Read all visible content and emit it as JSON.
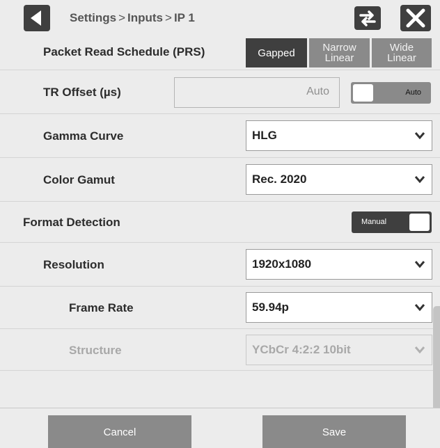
{
  "breadcrumb": {
    "part1": "Settings",
    "part2": "Inputs",
    "part3": "IP 1",
    "separator": ">"
  },
  "prs": {
    "label": "Packet Read Schedule (PRS)",
    "options": [
      {
        "line1": "Gapped",
        "line2": ""
      },
      {
        "line1": "Narrow",
        "line2": "Linear"
      },
      {
        "line1": "Wide",
        "line2": "Linear"
      }
    ],
    "selected": "Gapped"
  },
  "tr_offset": {
    "label": "TR Offset (µs)",
    "value": "Auto",
    "toggle_label": "Auto"
  },
  "gamma_curve": {
    "label": "Gamma Curve",
    "value": "HLG"
  },
  "color_gamut": {
    "label": "Color Gamut",
    "value": "Rec. 2020"
  },
  "format_detection": {
    "label": "Format Detection",
    "toggle_label": "Manual"
  },
  "resolution": {
    "label": "Resolution",
    "value": "1920x1080"
  },
  "frame_rate": {
    "label": "Frame Rate",
    "value": "59.94p"
  },
  "structure": {
    "label": "Structure",
    "value": "YCbCr 4:2:2 10bit"
  },
  "footer": {
    "cancel": "Cancel",
    "save": "Save"
  },
  "colors": {
    "dark_button": "#3f3f3f",
    "inactive_button": "#8a8a8a",
    "background": "#ececec"
  }
}
